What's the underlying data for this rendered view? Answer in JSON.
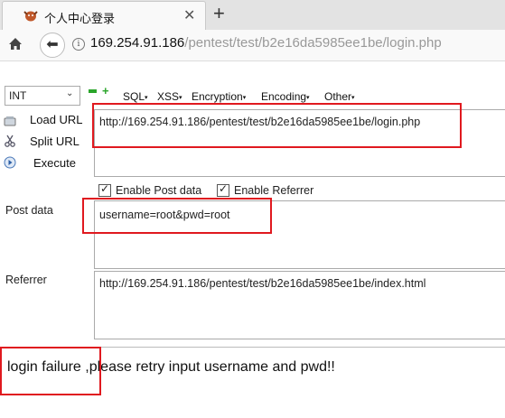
{
  "tab": {
    "title": "个人中心登录",
    "close_icon": "close-icon",
    "new_tab_label": "+"
  },
  "nav": {
    "url_host": "169.254.91.186",
    "url_path": "/pentest/test/b2e16da5985ee1be/login.php"
  },
  "hackbar": {
    "selected_type": "INT",
    "menus": [
      "SQL",
      "XSS",
      "Encryption",
      "Encoding",
      "Other"
    ],
    "actions": [
      "Load URL",
      "Split URL",
      "Execute"
    ],
    "url_value": "http://169.254.91.186/pentest/test/b2e16da5985ee1be/login.php",
    "enable_post_label": "Enable Post data",
    "enable_referrer_label": "Enable Referrer",
    "post_label": "Post data",
    "post_value": "username=root&pwd=root",
    "referrer_label": "Referrer",
    "referrer_value": "http://169.254.91.186/pentest/test/b2e16da5985ee1be/index.html"
  },
  "result_text": "login failure ,please retry input username and pwd!!",
  "colors": {
    "highlight": "#e0191f",
    "hackbar_green": "#2aa52a"
  }
}
